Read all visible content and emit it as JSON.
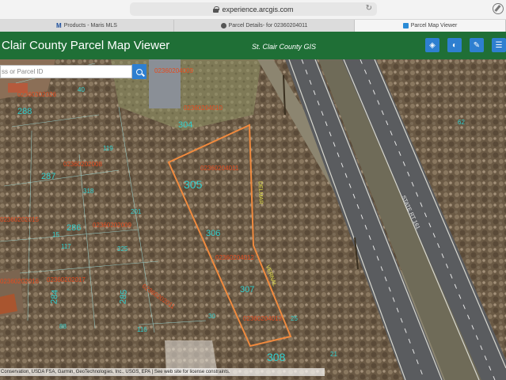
{
  "browser": {
    "url": "experience.arcgis.com",
    "tabs": [
      {
        "label": "Products - Maris MLS",
        "icon": "m-logo"
      },
      {
        "label": "Parcel Details- for 02360204011",
        "icon": "circle-icon"
      },
      {
        "label": "Parcel Map Viewer",
        "icon": "parcel-map-icon"
      }
    ],
    "m_logo": "M"
  },
  "app": {
    "title": "Clair County Parcel Map Viewer",
    "subtitle": "St. Clair County GIS",
    "header_buttons": [
      "layers-icon",
      "basemap-icon",
      "measure-icon",
      "list-icon"
    ]
  },
  "search": {
    "placeholder": "ss or Parcel ID"
  },
  "map": {
    "attribution": "Conservation, USDA FSA, Garmin, GeoTechnologies, Inc., USGS, EPA | See web site for license constraints.",
    "highway_label": "STATE RT 161",
    "road_label_1": "DELMAR",
    "road_label_2": "VERNAL",
    "parcel_ids": [
      "02360204009",
      "02360202026",
      "02360204010",
      "02360204011",
      "02360202008",
      "02360202015",
      "02360202009",
      "02360204012",
      "02360202017",
      "02360202016",
      "02360204013",
      "02360202011"
    ],
    "addresses": [
      "288",
      "304",
      "287",
      "305",
      "286",
      "306",
      "284",
      "285",
      "307",
      "308",
      "116"
    ],
    "small_addresses": [
      "40",
      "119",
      "318",
      "201",
      "117",
      "325",
      "15",
      "30",
      "62",
      "21",
      "25",
      "88"
    ]
  },
  "colors": {
    "header_green": "#1f6f36",
    "button_blue": "#2e7fd0",
    "parcel_outline": "#f08a3e",
    "parcel_id_text": "#e34b1f",
    "address_text": "#31d0cf"
  }
}
